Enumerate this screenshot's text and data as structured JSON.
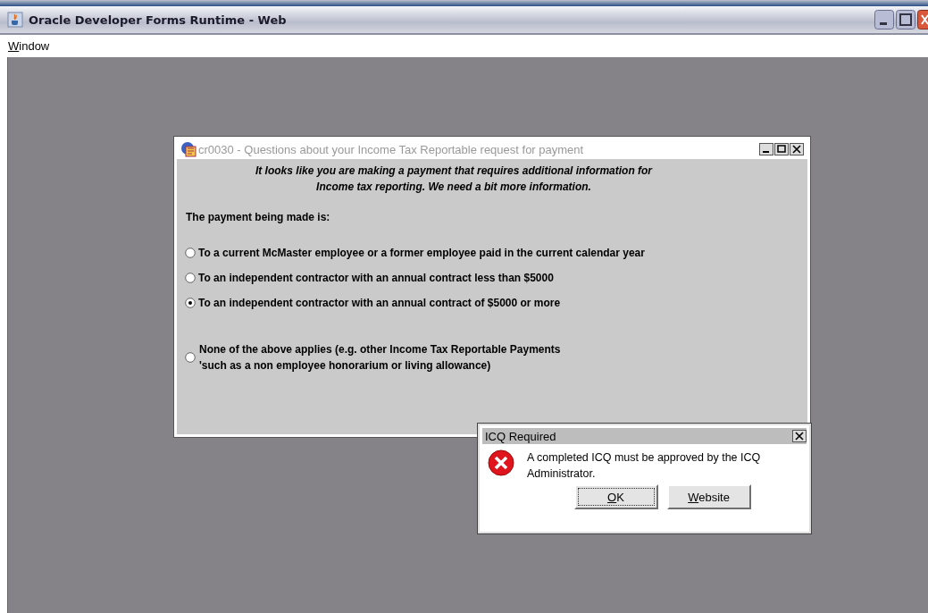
{
  "window": {
    "title": "Oracle Developer Forms Runtime - Web"
  },
  "menu_bar": [
    {
      "label": "Window",
      "mnemonic": true
    }
  ],
  "form_window": {
    "title": "cr0030 - Questions about your Income Tax Reportable request for payment",
    "intro": [
      "It looks like you are making a payment that requires additional information for",
      "Income tax reporting.  We need a bit more information."
    ],
    "question": "The payment being made is:",
    "options": [
      {
        "lines": [
          "To a current McMaster employee or a former employee paid in the current calendar year"
        ],
        "selected": false
      },
      {
        "lines": [
          "To an independent contractor with an annual contract less than $5000"
        ],
        "selected": false
      },
      {
        "lines": [
          "To an independent contractor with an annual contract of $5000 or more"
        ],
        "selected": true
      },
      {
        "lines": [
          "None of the above applies (e.g. other Income Tax Reportable Payments",
          "'such as a non employee honorarium or living allowance)"
        ],
        "selected": false
      }
    ]
  },
  "dialog": {
    "title": "ICQ Required",
    "message": "A completed ICQ must be approved by the ICQ Administrator.",
    "buttons": [
      {
        "label": "OK",
        "mnemonic": true,
        "focused": true
      },
      {
        "label": "Website",
        "mnemonic": true,
        "focused": false
      }
    ]
  }
}
